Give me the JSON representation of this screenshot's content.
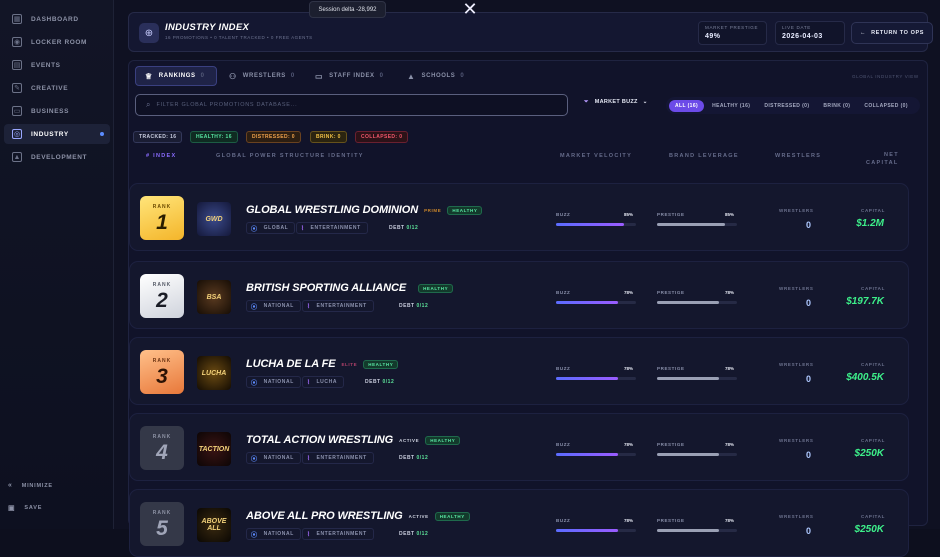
{
  "sidebar": {
    "items": [
      {
        "label": "DASHBOARD",
        "icon": "dashboard-icon"
      },
      {
        "label": "LOCKER ROOM",
        "icon": "people-icon"
      },
      {
        "label": "EVENTS",
        "icon": "calendar-icon"
      },
      {
        "label": "CREATIVE",
        "icon": "pen-icon"
      },
      {
        "label": "BUSINESS",
        "icon": "briefcase-icon"
      },
      {
        "label": "INDUSTRY",
        "icon": "globe-icon"
      },
      {
        "label": "DEVELOPMENT",
        "icon": "graduation-cap-icon"
      }
    ],
    "active": "INDUSTRY",
    "minimize_label": "MINIMIZE",
    "save_label": "SAVE"
  },
  "toast": {
    "text": "Session delta -28,992"
  },
  "header": {
    "title": "INDUSTRY INDEX",
    "subtitle": "16 PROMOTIONS • 0 TALENT TRACKED • 0 FREE AGENTS",
    "market_prestige_label": "MARKET PRESTIGE",
    "market_prestige_value": "49%",
    "live_date_label": "LIVE DATE",
    "live_date_value": "2026-04-03",
    "return_label": "RETURN TO OPS"
  },
  "tabs": [
    {
      "label": "RANKINGS",
      "count": "0"
    },
    {
      "label": "WRESTLERS",
      "count": "0"
    },
    {
      "label": "STAFF INDEX",
      "count": "0"
    },
    {
      "label": "SCHOOLS",
      "count": "0"
    }
  ],
  "tabs_right_label": "GLOBAL INDUSTRY VIEW",
  "search": {
    "placeholder": "FILTER GLOBAL PROMOTIONS DATABASE..."
  },
  "sort": {
    "label": "MARKET BUZZ"
  },
  "filters": [
    "ALL (16)",
    "HEALTHY (16)",
    "DISTRESSED (0)",
    "BRINK (0)",
    "COLLAPSED (0)"
  ],
  "badges": [
    {
      "label": "TRACKED: 16",
      "color": "#c9cde0"
    },
    {
      "label": "HEALTHY: 16",
      "color": "#56e3a0"
    },
    {
      "label": "DISTRESSED: 0",
      "color": "#f0a24c"
    },
    {
      "label": "BRINK: 0",
      "color": "#f3c347"
    },
    {
      "label": "COLLAPSED: 0",
      "color": "#f0566a"
    }
  ],
  "columns": {
    "index": "# INDEX",
    "identity": "GLOBAL POWER STRUCTURE IDENTITY",
    "velocity": "MARKET VELOCITY",
    "leverage": "BRAND LEVERAGE",
    "wrestlers": "WRESTLERS",
    "capital_line1": "NET",
    "capital_line2": "CAPITAL"
  },
  "rows": [
    {
      "rank": "1",
      "rank_label": "RANK",
      "name": "GLOBAL WRESTLING DOMINION",
      "logo": "GWD",
      "status1": "PRIME",
      "status2": "HEALTHY",
      "scope": "GLOBAL",
      "style": "ENTERTAINMENT",
      "debt_label": "DEBT",
      "debt": "0/12",
      "buzz_label": "BUZZ",
      "buzz": "85%",
      "buzz_value": 85,
      "prestige_label": "PRESTIGE",
      "prestige": "85%",
      "prestige_value": 85,
      "wrestlers_label": "WRESTLERS",
      "wrestlers": "0",
      "capital_label": "CAPITAL",
      "capital": "$1.2M"
    },
    {
      "rank": "2",
      "rank_label": "RANK",
      "name": "BRITISH SPORTING ALLIANCE",
      "logo": "BSA",
      "status1": "",
      "status2": "HEALTHY",
      "scope": "NATIONAL",
      "style": "ENTERTAINMENT",
      "debt_label": "DEBT",
      "debt": "0/12",
      "buzz_label": "BUZZ",
      "buzz": "78%",
      "buzz_value": 78,
      "prestige_label": "PRESTIGE",
      "prestige": "78%",
      "prestige_value": 78,
      "wrestlers_label": "WRESTLERS",
      "wrestlers": "0",
      "capital_label": "CAPITAL",
      "capital": "$197.7K"
    },
    {
      "rank": "3",
      "rank_label": "RANK",
      "name": "LUCHA DE LA FE",
      "logo": "LUCHA",
      "status1": "ELITE",
      "status2": "HEALTHY",
      "scope": "NATIONAL",
      "style": "LUCHA",
      "debt_label": "DEBT",
      "debt": "0/12",
      "buzz_label": "BUZZ",
      "buzz": "78%",
      "buzz_value": 78,
      "prestige_label": "PRESTIGE",
      "prestige": "78%",
      "prestige_value": 78,
      "wrestlers_label": "WRESTLERS",
      "wrestlers": "0",
      "capital_label": "CAPITAL",
      "capital": "$400.5K"
    },
    {
      "rank": "4",
      "rank_label": "RANK",
      "name": "TOTAL ACTION WRESTLING",
      "logo": "TACTION",
      "status1": "ACTIVE",
      "status2": "HEALTHY",
      "scope": "NATIONAL",
      "style": "ENTERTAINMENT",
      "debt_label": "DEBT",
      "debt": "0/12",
      "buzz_label": "BUZZ",
      "buzz": "78%",
      "buzz_value": 78,
      "prestige_label": "PRESTIGE",
      "prestige": "78%",
      "prestige_value": 78,
      "wrestlers_label": "WRESTLERS",
      "wrestlers": "0",
      "capital_label": "CAPITAL",
      "capital": "$250K"
    },
    {
      "rank": "5",
      "rank_label": "RANK",
      "name": "ABOVE ALL PRO WRESTLING",
      "logo": "ABOVE ALL",
      "status1": "ACTIVE",
      "status2": "HEALTHY",
      "scope": "NATIONAL",
      "style": "ENTERTAINMENT",
      "debt_label": "DEBT",
      "debt": "0/12",
      "buzz_label": "BUZZ",
      "buzz": "78%",
      "buzz_value": 78,
      "prestige_label": "PRESTIGE",
      "prestige": "78%",
      "prestige_value": 78,
      "wrestlers_label": "WRESTLERS",
      "wrestlers": "0",
      "capital_label": "CAPITAL",
      "capital": "$250K"
    }
  ],
  "colors": {
    "accent": "#6c4be8",
    "capital": "#3df08a",
    "healthy": "#59e8a4"
  }
}
